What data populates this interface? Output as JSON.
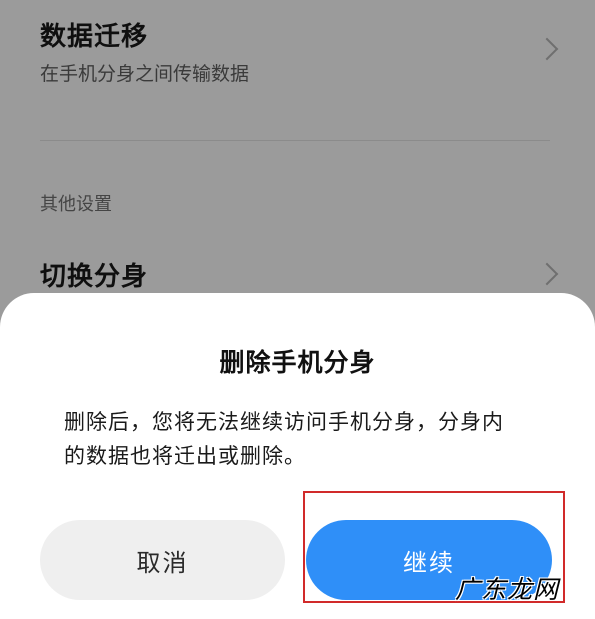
{
  "settings": {
    "migration": {
      "title": "数据迁移",
      "subtitle": "在手机分身之间传输数据"
    },
    "section_other": "其他设置",
    "switch": {
      "title": "切换分身"
    }
  },
  "dialog": {
    "title": "删除手机分身",
    "message": "删除后，您将无法继续访问手机分身，分身内的数据也将迁出或删除。",
    "cancel_label": "取消",
    "continue_label": "继续"
  },
  "watermark": "广东龙网",
  "colors": {
    "accent": "#2f8ff8",
    "highlight": "#d12a2a"
  }
}
